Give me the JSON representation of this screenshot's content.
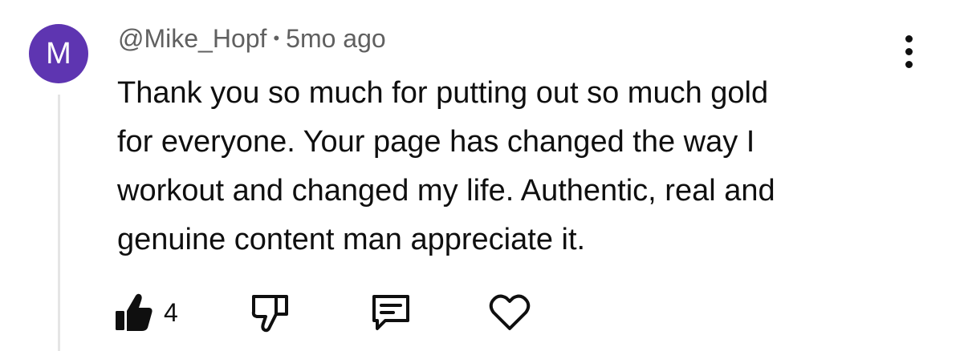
{
  "comment": {
    "avatar_letter": "M",
    "author": "@Mike_Hopf",
    "separator": "•",
    "timestamp": "5mo ago",
    "body_lines": [
      "Thank you so much for putting out so much gold",
      "for everyone. Your page has changed the way I",
      "workout and changed my life. Authentic, real and",
      "genuine content man appreciate it."
    ],
    "like_count": "4"
  },
  "colors": {
    "avatar_bg": "#5e35b1",
    "meta_text": "#606060",
    "thread_line": "#e5e5e5"
  },
  "icons": {
    "menu": "more-vert-icon",
    "like": "thumbs-up-filled-icon",
    "dislike": "thumbs-down-icon",
    "reply": "comment-icon",
    "heart": "heart-icon"
  }
}
